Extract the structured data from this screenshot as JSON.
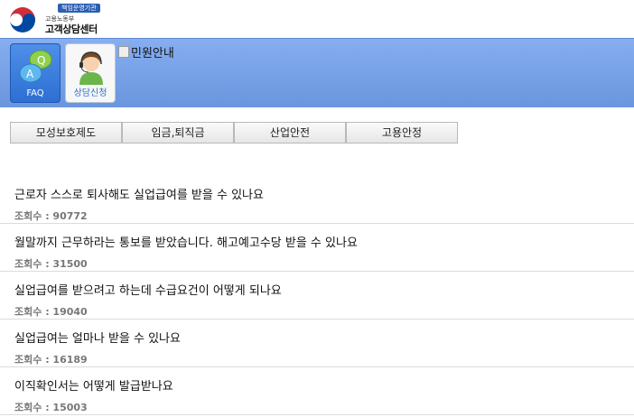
{
  "header": {
    "badge": "책임운영기관",
    "ministry": "고용노동부",
    "center": "고객상담센터"
  },
  "toolbar": {
    "faq_label": "FAQ",
    "consult_label": "상담신청",
    "civil_link": "민원안내"
  },
  "tabs": [
    "모성보호제도",
    "임금,퇴직금",
    "산업안전",
    "고용안정"
  ],
  "views_prefix": "조회수 : ",
  "faq_items": [
    {
      "question": "근로자 스스로 퇴사해도 실업급여를 받을 수 있나요",
      "views": "조회수 : 90772"
    },
    {
      "question": "월말까지 근무하라는 통보를 받았습니다. 해고예고수당 받을 수 있나요",
      "views": "조회수 : 31500"
    },
    {
      "question": "실업급여를 받으려고 하는데 수급요건이 어떻게 되나요",
      "views": "조회수 : 19040"
    },
    {
      "question": "실업급여는 얼마나 받을 수 있나요",
      "views": "조회수 : 16189"
    },
    {
      "question": "이직확인서는 어떻게 발급받나요",
      "views": "조회수 : 15003"
    }
  ]
}
